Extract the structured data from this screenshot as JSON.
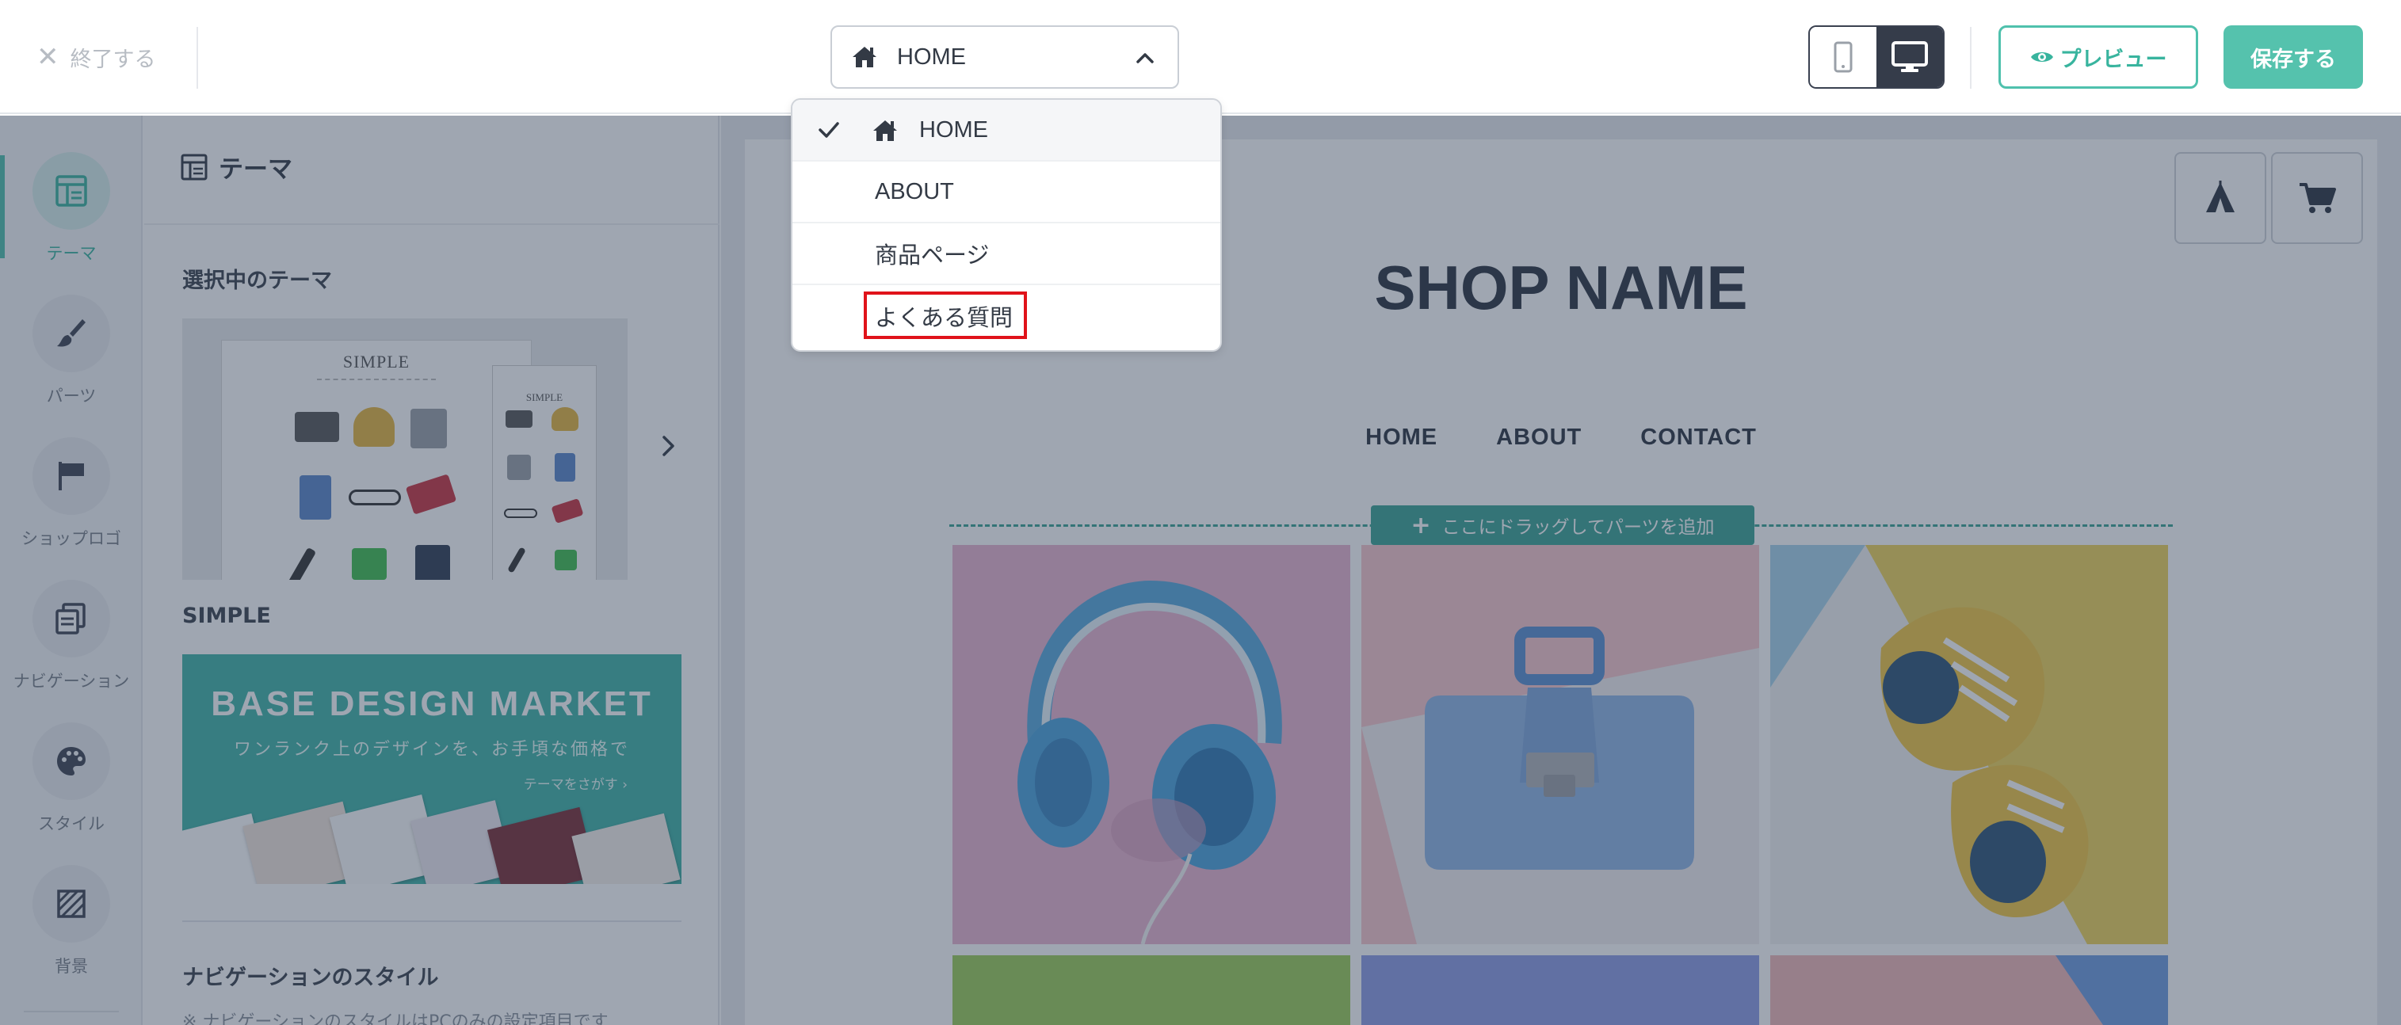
{
  "header": {
    "exit_label": "終了する",
    "page_selector": {
      "selected": "HOME",
      "icon": "home-icon",
      "state": "open"
    },
    "device_toggle": {
      "options": [
        "mobile",
        "desktop"
      ],
      "active": "desktop"
    },
    "preview_label": "プレビュー",
    "save_label": "保存する"
  },
  "rail": {
    "items": [
      {
        "label": "テーマ",
        "icon": "layout-icon",
        "active": true
      },
      {
        "label": "パーツ",
        "icon": "brush-icon",
        "active": false
      },
      {
        "label": "ショップロゴ",
        "icon": "logo-flag-icon",
        "active": false
      },
      {
        "label": "ナビゲーション",
        "icon": "navigation-icon",
        "active": false
      },
      {
        "label": "スタイル",
        "icon": "palette-icon",
        "active": false
      },
      {
        "label": "背景",
        "icon": "background-pattern-icon",
        "active": false
      }
    ]
  },
  "theme_panel": {
    "title": "テーマ",
    "current_theme_heading": "選択中のテーマ",
    "theme_preview_brand": "SIMPLE",
    "theme_name": "SIMPLE",
    "banner": {
      "title": "BASE DESIGN MARKET",
      "subtitle": "ワンランク上のデザインを、お手頃な価格で",
      "link": "テーマをさがす"
    },
    "nav_style_heading": "ナビゲーションのスタイル",
    "nav_style_note": "※ ナビゲーションのスタイルはPCのみの設定項目です"
  },
  "canvas": {
    "shop_name": "SHOP NAME",
    "nav": [
      "HOME",
      "ABOUT",
      "CONTACT"
    ],
    "dropzone_label": "ここにドラッグしてパーツを追加",
    "corner_buttons": [
      "tent-icon",
      "cart-icon"
    ],
    "products": [
      {
        "name": "headphones",
        "bg": "#e9b3cf"
      },
      {
        "name": "handbag",
        "bg": "#f7c6cb"
      },
      {
        "name": "sneakers",
        "bg": "#f2f2f2"
      }
    ]
  },
  "dropdown": {
    "items": [
      {
        "label": "HOME",
        "selected": true,
        "icon": "home-icon"
      },
      {
        "label": "ABOUT",
        "selected": false
      },
      {
        "label": "商品ページ",
        "selected": false
      },
      {
        "label": "よくある質問",
        "selected": false,
        "highlighted": true
      }
    ]
  },
  "colors": {
    "accent": "#4fc1ad",
    "dark": "#353c4a",
    "overlay": "rgba(46,61,86,0.46)",
    "highlight": "#e0131a"
  }
}
